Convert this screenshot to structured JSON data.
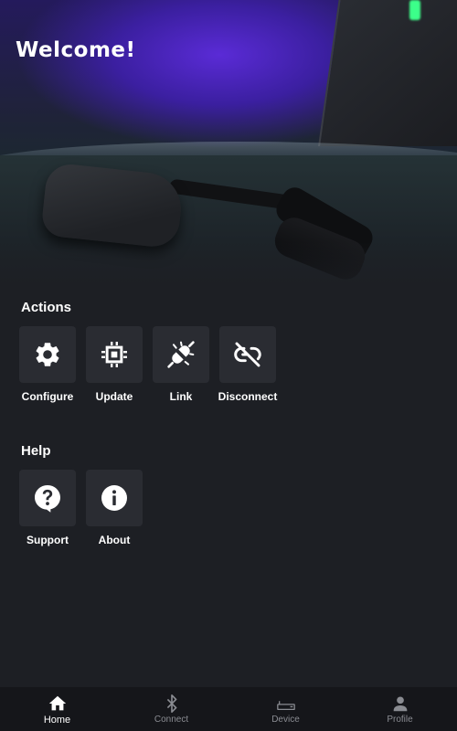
{
  "header": {
    "title": "Welcome!"
  },
  "actions": {
    "title": "Actions",
    "items": [
      {
        "label": "Configure",
        "icon": "gear-icon"
      },
      {
        "label": "Update",
        "icon": "chip-icon"
      },
      {
        "label": "Link",
        "icon": "plug-icon"
      },
      {
        "label": "Disconnect",
        "icon": "unlink-icon"
      }
    ]
  },
  "help": {
    "title": "Help",
    "items": [
      {
        "label": "Support",
        "icon": "question-bubble-icon"
      },
      {
        "label": "About",
        "icon": "info-icon"
      }
    ]
  },
  "nav": {
    "items": [
      {
        "label": "Home",
        "icon": "home-icon",
        "active": true
      },
      {
        "label": "Connect",
        "icon": "bluetooth-icon",
        "active": false
      },
      {
        "label": "Device",
        "icon": "device-icon",
        "active": false
      },
      {
        "label": "Profile",
        "icon": "person-icon",
        "active": false
      }
    ]
  },
  "colors": {
    "background": "#1d1f24",
    "tile": "#2a2c32",
    "nav_bar": "#15161a",
    "nav_active": "#ffffff",
    "nav_inactive": "#8a8c92"
  }
}
